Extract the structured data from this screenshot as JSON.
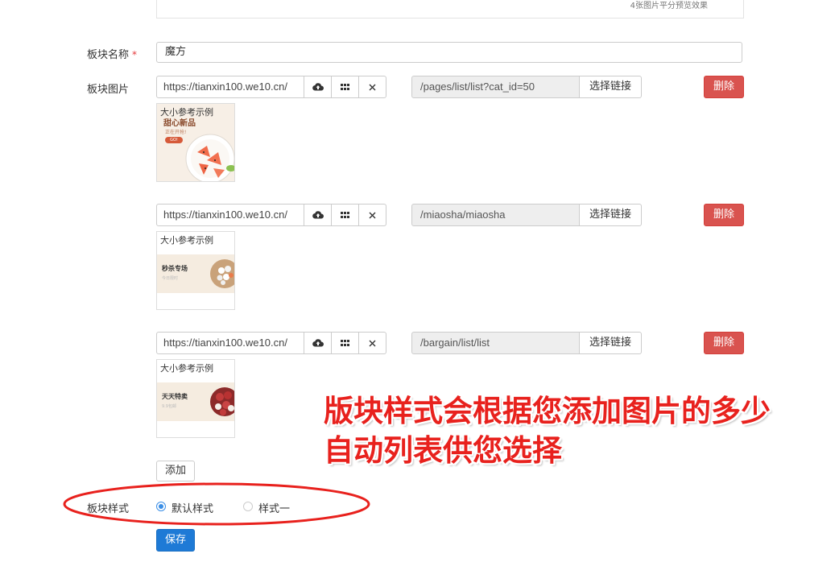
{
  "top_panel": {
    "note": "4张图片平分预览效果"
  },
  "form": {
    "name_label": "板块名称",
    "required_mark": "*",
    "name_value": "魔方",
    "image_label": "板块图片",
    "style_label": "板块样式"
  },
  "image_rows": [
    {
      "url": "https://tianxin100.we10.cn/",
      "link": "/pages/list/list?cat_id=50",
      "choose_link": "选择链接",
      "delete": "删除",
      "thumb": {
        "caption": "大小参考示例",
        "title": "甜心新品",
        "subtitle": "正在开抢!",
        "button": "GO!"
      }
    },
    {
      "url": "https://tianxin100.we10.cn/",
      "link": "/miaosha/miaosha",
      "choose_link": "选择链接",
      "delete": "删除",
      "thumb": {
        "caption": "大小参考示例",
        "title": "秒杀专场",
        "subtitle": "今日限时"
      }
    },
    {
      "url": "https://tianxin100.we10.cn/",
      "link": "/bargain/list/list",
      "choose_link": "选择链接",
      "delete": "删除",
      "thumb": {
        "caption": "大小参考示例",
        "title": "天天特卖",
        "subtitle": "9.9包邮"
      }
    }
  ],
  "icons": {
    "upload": "cloud-upload-icon",
    "gallery": "grid-icon",
    "clear": "close-icon"
  },
  "add_button": "添加",
  "style_options": [
    {
      "label": "默认样式",
      "selected": true
    },
    {
      "label": "样式一",
      "selected": false
    }
  ],
  "save_button": "保存",
  "annotation": {
    "line1": "版块样式会根据您添加图片的多少",
    "line2": "自动列表供您选择",
    "color": "#e8211d"
  },
  "colors": {
    "danger": "#d9534f",
    "primary": "#1e7ad6",
    "radio_active": "#3a8ee6"
  }
}
